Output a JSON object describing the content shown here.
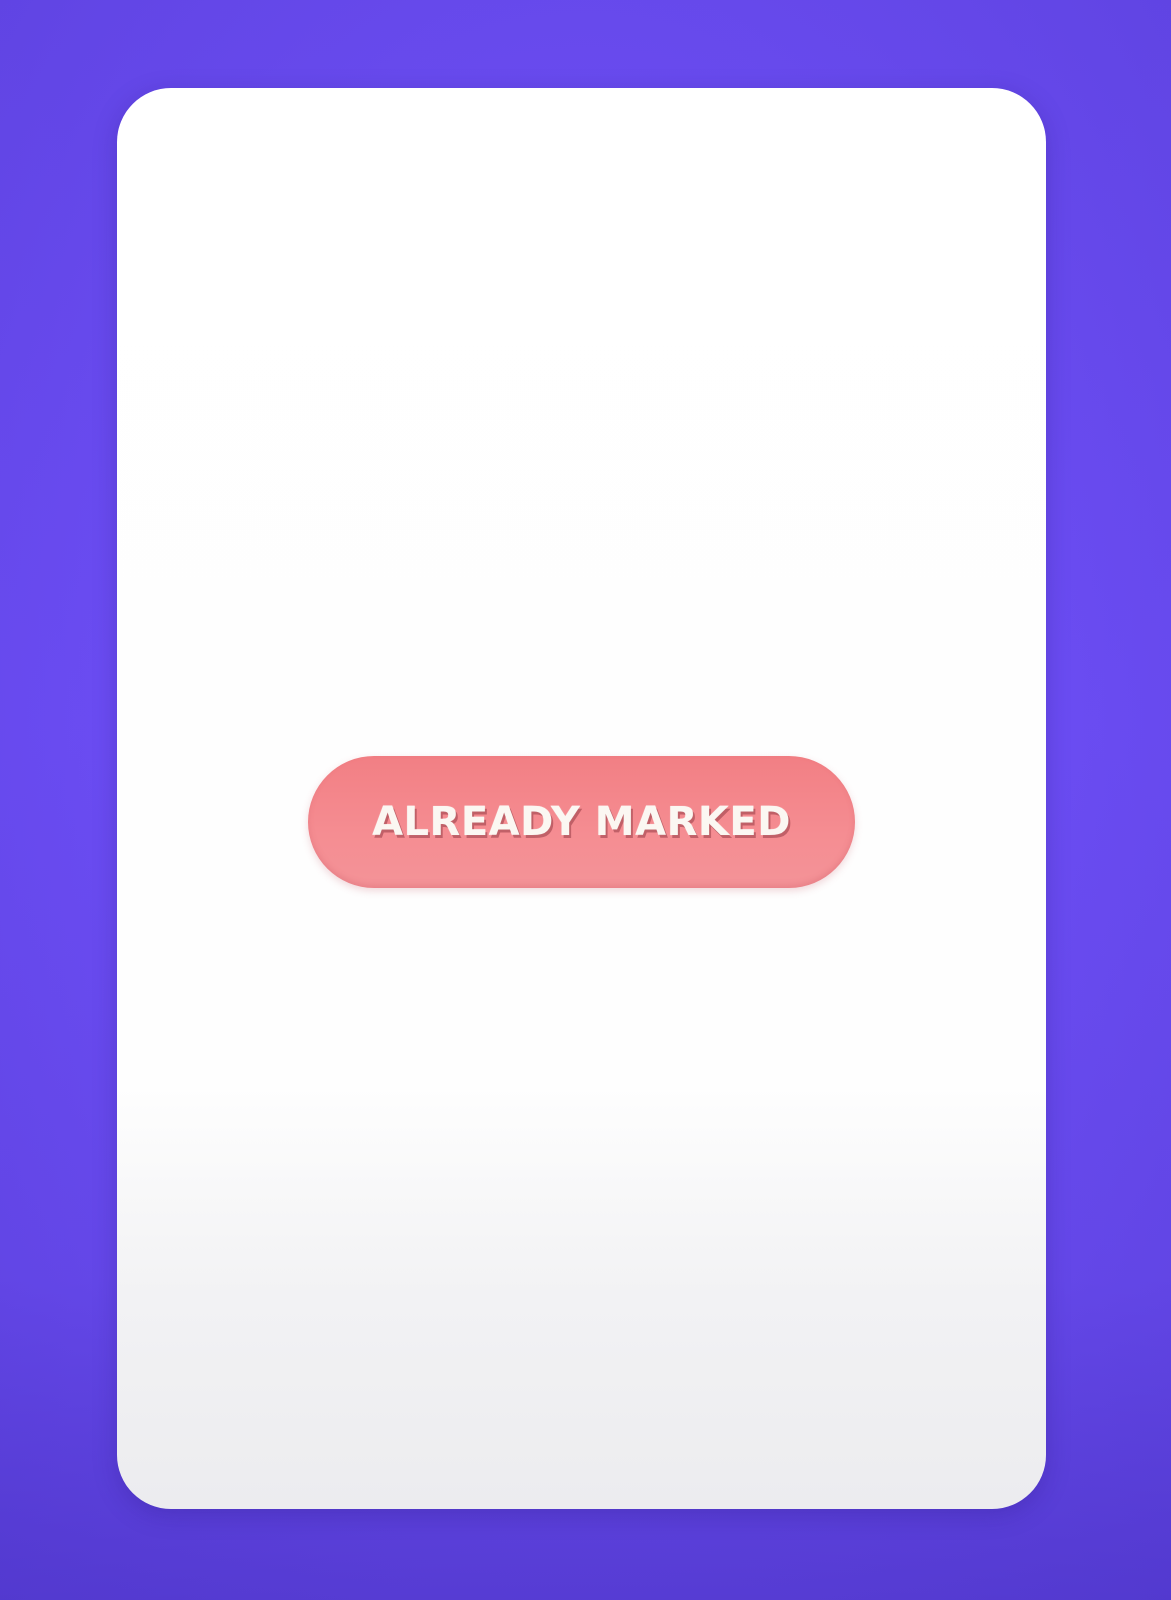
{
  "card": {
    "status_badge_label": "ALREADY MARKED"
  },
  "colors": {
    "background": "#6e4ff7",
    "card": "#ffffff",
    "badge": "#f58d92",
    "badge_text": "#fbf7f2"
  }
}
